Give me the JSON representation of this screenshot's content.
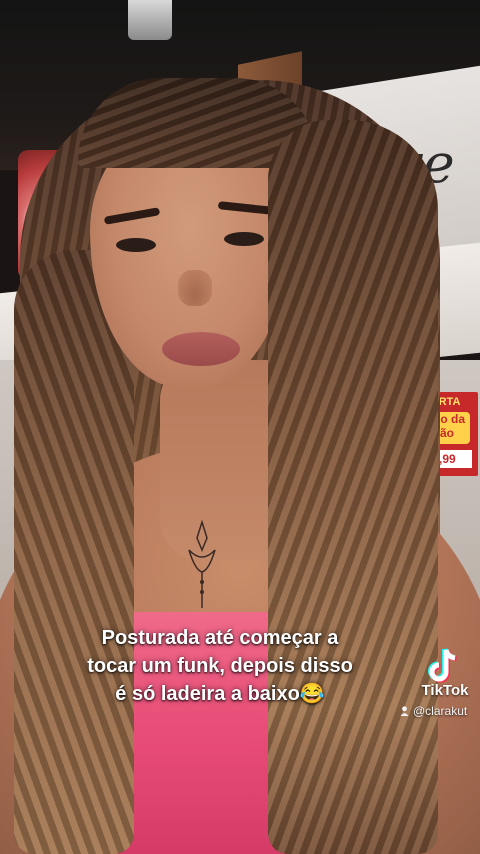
{
  "video": {
    "caption_lines": [
      "Posturada até começar a",
      "tocar um funk, depois disso",
      "é só ladeira a baixo😂"
    ]
  },
  "watermark": {
    "brand": "TikTok",
    "username": "@clarakut",
    "icons": [
      "tiktok-logo-icon",
      "user-icon"
    ]
  },
  "background_signage": {
    "offer_poster_title": "OFERTA",
    "offer_poster_product": "Bolo da Pão",
    "offer_poster_price": "2,99"
  },
  "colors": {
    "caption_text": "#ffffff",
    "top_pink": "#e84c77",
    "poster_red": "#c7282a"
  }
}
